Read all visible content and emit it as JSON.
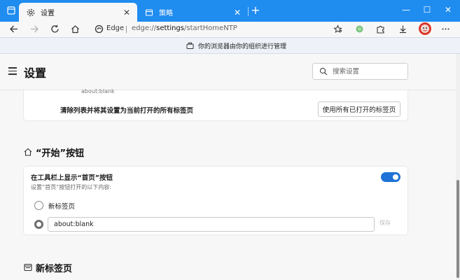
{
  "window": {
    "tabs": [
      {
        "label": "设置",
        "icon": "gear-icon",
        "active": true
      },
      {
        "label": "策略",
        "icon": "document-icon",
        "active": false
      }
    ],
    "new_tab": "+",
    "minimize": "—",
    "maximize": "☐",
    "close": "✕"
  },
  "toolbar": {
    "edge_label": "Edge",
    "url_prefix": "edge://",
    "url_main": "settings",
    "url_suffix": "/startHomeNTP"
  },
  "infobar": {
    "text": "你的浏览器由你的组织进行管理"
  },
  "header": {
    "title": "设置",
    "search_placeholder": "搜索设置"
  },
  "startup": {
    "faded_text": "about:blank",
    "clear_label": "清除列表并将其设置为当前打开的所有标签页",
    "use_open_button": "使用所有已打开的标签页"
  },
  "home_section": {
    "title": "“开始”按钮",
    "show_label": "在工具栏上显示“首页”按钮",
    "show_sub": "设置“首页”按钮打开的以下内容:",
    "toggle_on": true,
    "options": [
      {
        "label": "新标签页",
        "selected": false
      },
      {
        "label": "",
        "selected": true
      }
    ],
    "url_value": "about:blank",
    "save_label": "保存"
  },
  "newtab_section": {
    "title": "新标签页"
  },
  "colors": {
    "titlebar": "#1f8cf0",
    "toggle": "#1f72d6"
  }
}
